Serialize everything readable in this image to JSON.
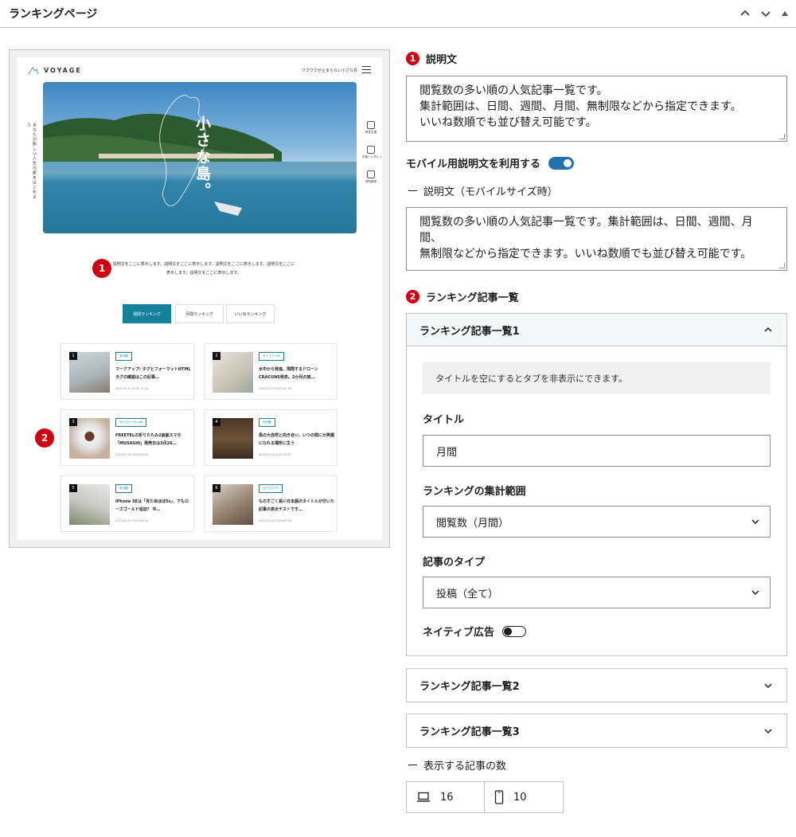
{
  "panel": {
    "title": "ランキングページ",
    "up_icon": "chevron-up",
    "down_icon": "chevron-down",
    "move_icon": "triangle-up"
  },
  "preview": {
    "logo": "VOYAGE",
    "tagline": "ワクワクが止まらない小さな島",
    "vertical_text": "あなたの新しい人生の旅をはじめよう",
    "hero_title": "小さな島。",
    "side_icons": [
      {
        "label": "移住支援"
      },
      {
        "label": "先輩インタビュー"
      },
      {
        "label": "資料請求"
      }
    ],
    "description": "説明文をここに表示します。説明文をここに表示します。説明文をここに表示します。説明文をここに表示します。説明文をここに表示します。",
    "tabs": [
      {
        "label": "週間ランキング",
        "active": true
      },
      {
        "label": "月間ランキング",
        "active": false
      },
      {
        "label": "いいねランキング",
        "active": false
      }
    ],
    "badge_1": "1",
    "badge_2": "2",
    "cards": [
      {
        "num": "1",
        "category": "未分類",
        "title": "マークアップ: タグとフォーマットHTMLタグの確認はこの記事…",
        "dates": "2023.05.17  2025.10.14"
      },
      {
        "num": "2",
        "category": "カテゴリー02",
        "title": "水中から発進、飛翔するドローンCRACUNS発表。2か月の旅…",
        "dates": "2024.01.10  2025.02.05"
      },
      {
        "num": "3",
        "category": "カテゴリー02 sub",
        "title": "FREETELの折りたたみ2画面スマホ「MUSASHI」発売日は3月26…",
        "dates": "2014.07.09  2025.03.24"
      },
      {
        "num": "4",
        "category": "未分類",
        "title": "島の大自然と向き合い、いつの間にか笑顔になれる場所に生う",
        "dates": "2025.02.10  2025.10.07"
      },
      {
        "num": "5",
        "category": "未分類",
        "title": "iPhone SEは「見た目ほぼ5s」、でもローズゴールド追加？ 中…",
        "dates": "2013.01.05  2024.04.23"
      },
      {
        "num": "6",
        "category": "カテゴリー1",
        "title": "ものすごく長い日本語のタイトルが付いた記事の表示テストです…",
        "dates": "2023.01.05  2024.09.16"
      }
    ]
  },
  "section1": {
    "badge": "1",
    "label": "説明文",
    "text": "閲覧数の多い順の人気記事一覧です。\n集計範囲は、日間、週間、月間、無制限などから指定できます。\nいいね数順でも並び替え可能です。"
  },
  "mobile": {
    "toggle_label": "モバイル用説明文を利用する",
    "toggle_on": true,
    "sub_label": "説明文（モバイルサイズ時）",
    "text": "閲覧数の多い順の人気記事一覧です。集計範囲は、日間、週間、月間、\n無制限などから指定できます。いいね数順でも並び替え可能です。"
  },
  "section2": {
    "badge": "2",
    "label": "ランキング記事一覧"
  },
  "accordion1": {
    "title": "ランキング記事一覧1",
    "notice": "タイトルを空にするとタブを非表示にできます。",
    "title_label": "タイトル",
    "title_value": "月間",
    "range_label": "ランキングの集計範囲",
    "range_value": "閲覧数（月間）",
    "type_label": "記事のタイプ",
    "type_value": "投稿（全て）",
    "ad_label": "ネイティブ広告",
    "ad_on": false
  },
  "accordion2": {
    "title": "ランキング記事一覧2"
  },
  "accordion3": {
    "title": "ランキング記事一覧3"
  },
  "count": {
    "label": "表示する記事の数",
    "desktop_value": "16",
    "mobile_value": "10",
    "desktop_icon": "laptop-icon",
    "mobile_icon": "smartphone-icon"
  },
  "colors": {
    "accent": "#2271b1",
    "badge": "#d10010",
    "preview_accent": "#14809c"
  }
}
